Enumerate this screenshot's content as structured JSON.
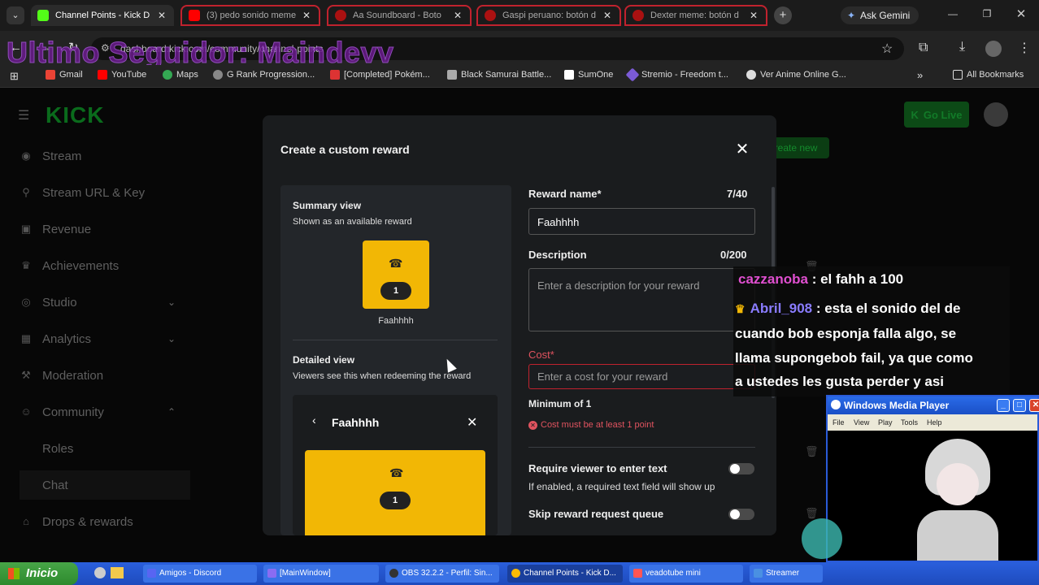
{
  "browser": {
    "tabs": [
      {
        "label": "Channel Points - Kick D",
        "active": true,
        "fav_color": "#53fc18"
      },
      {
        "label": "(3) pedo sonido meme",
        "fav_color": "#ff0000"
      },
      {
        "label": "Aa Soundboard - Boto",
        "fav_color": "#a11"
      },
      {
        "label": "Gaspi peruano: botón d",
        "fav_color": "#a11"
      },
      {
        "label": "Dexter meme: botón d",
        "fav_color": "#a11"
      }
    ],
    "new_tab": "+",
    "ask_gemini": "Ask Gemini",
    "url": "dashboard.kick.com/community/channel-points",
    "bookmarks": [
      {
        "label": "Gmail",
        "color": "#ea4335"
      },
      {
        "label": "YouTube",
        "color": "#ff0000"
      },
      {
        "label": "Maps",
        "color": "#34a853"
      },
      {
        "label": "G Rank Progression...",
        "color": "#888"
      },
      {
        "label": "[Completed] Pokém...",
        "color": "#d33"
      },
      {
        "label": "Black Samurai Battle...",
        "color": "#aaa"
      },
      {
        "label": "SumOne",
        "color": "#fff"
      },
      {
        "label": "Stremio - Freedom t...",
        "color": "#7b5bd6"
      },
      {
        "label": "Ver Anime Online G...",
        "color": "#ddd"
      }
    ],
    "all_bookmarks": "All Bookmarks"
  },
  "overlay": {
    "follower_text": "Ultimo Seguidor: Maindevv"
  },
  "kick": {
    "logo": "KICK",
    "go_live": "Go Live",
    "create_new": "Create new",
    "nav": [
      {
        "label": "Stream",
        "icon": "stream-icon"
      },
      {
        "label": "Stream URL & Key",
        "icon": "key-icon"
      },
      {
        "label": "Revenue",
        "icon": "revenue-icon"
      },
      {
        "label": "Achievements",
        "icon": "trophy-icon"
      },
      {
        "label": "Studio",
        "icon": "studio-icon",
        "chevron": "down"
      },
      {
        "label": "Analytics",
        "icon": "analytics-icon",
        "chevron": "down"
      },
      {
        "label": "Moderation",
        "icon": "moderation-icon"
      },
      {
        "label": "Community",
        "icon": "community-icon",
        "chevron": "up"
      },
      {
        "label": "Roles",
        "sub": true
      },
      {
        "label": "Chat",
        "sub": true,
        "selected": true
      },
      {
        "label": "Drops & rewards",
        "icon": "drops-icon"
      }
    ]
  },
  "modal": {
    "title": "Create a custom reward",
    "summary_title": "Summary view",
    "summary_sub": "Shown as an available reward",
    "reward_name": "Faahhhh",
    "reward_cost": "1",
    "detailed_title": "Detailed view",
    "detailed_sub": "Viewers see this when redeeming the reward",
    "reward_name_label": "Reward name*",
    "reward_name_count": "7/40",
    "description_label": "Description",
    "description_count": "0/200",
    "description_placeholder": "Enter a description for your reward",
    "cost_label": "Cost*",
    "cost_placeholder": "Enter a cost for your reward",
    "minimum": "Minimum of 1",
    "cost_error": "Cost must be at least 1 point",
    "require_text_label": "Require viewer to enter text",
    "require_text_help": "If enabled, a required text field will show up",
    "skip_queue_label": "Skip reward request queue"
  },
  "chat_overlay": {
    "lines": [
      {
        "user": "cazzanoba",
        "text": " : el fahh a 100",
        "color": "#e04fd0"
      },
      {
        "user": "Abril_908",
        "text": " : esta el sonido del de",
        "color": "#8a7cff"
      },
      {
        "text": "cuando bob esponja falla algo, se"
      },
      {
        "text": "llama supongebob fail, ya que como"
      },
      {
        "text": "a ustedes les gusta perder y asi"
      }
    ]
  },
  "media_player": {
    "title": "Windows Media Player",
    "menu": [
      "File",
      "View",
      "Play",
      "Tools",
      "Help"
    ]
  },
  "taskbar": {
    "start": "Inicio",
    "items": [
      {
        "label": "Amigos - Discord",
        "color": "#5865f2"
      },
      {
        "label": "[MainWindow]",
        "color": "#8a6cf2"
      },
      {
        "label": "OBS 32.2.2 - Perfil: Sin...",
        "color": "#333"
      },
      {
        "label": "Channel Points - Kick D...",
        "color": "#fbbc05",
        "active": true
      },
      {
        "label": "veadotube mini",
        "color": "#f55"
      },
      {
        "label": "Streamer",
        "color": "#4a90e2"
      }
    ]
  }
}
